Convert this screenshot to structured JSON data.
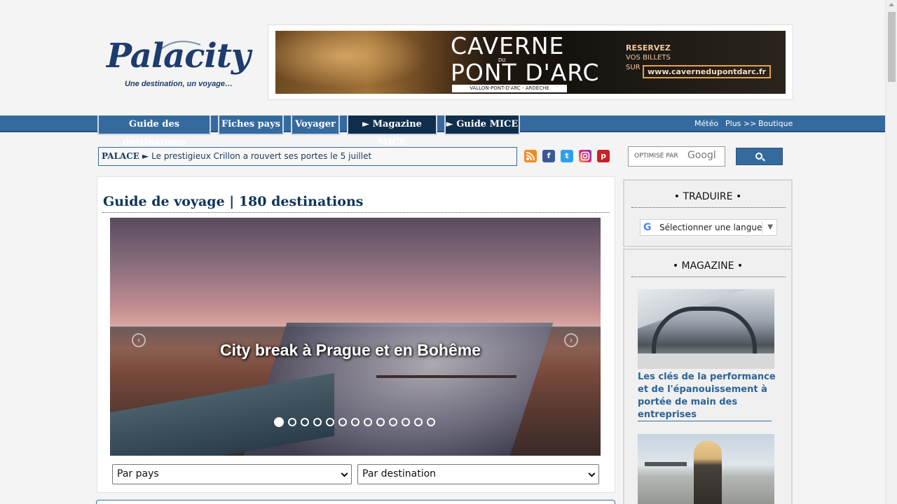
{
  "header": {
    "logo_text": "Palacity",
    "logo_tagline": "Une destination, un voyage…",
    "banner": {
      "title_line1": "CAVERNE",
      "title_du": "DU",
      "title_line2": "PONT D'ARC",
      "subtitle": "VALLON-PONT-D'ARC - ARDÈCHE",
      "reserve": "RESERVEZ",
      "vos_billets": "VOS BILLETS",
      "sur": "SUR",
      "url": "www.cavernedupontdarc.fr"
    }
  },
  "nav": {
    "tabs": [
      {
        "label": "Guide des destinations"
      },
      {
        "label": "Fiches pays"
      },
      {
        "label": "Voyager"
      },
      {
        "label": "► Magazine MICE"
      },
      {
        "label": "► Guide MICE"
      }
    ],
    "right": [
      "Météo",
      "Plus >>",
      "Boutique"
    ]
  },
  "ticker": {
    "label": "PALACE",
    "arrow": "►",
    "text": "Le prestigieux Crillon a rouvert ses portes le 5 juillet"
  },
  "social": [
    "rss-icon",
    "facebook-icon",
    "twitter-icon",
    "instagram-icon",
    "pinterest-icon"
  ],
  "search": {
    "label": "OPTIMISÉ PAR",
    "brand": "Googl"
  },
  "main": {
    "title": "Guide de voyage | 180 destinations",
    "slider": {
      "caption": "City break à Prague et en Bohême",
      "dot_count": 13,
      "active_dot": 0
    },
    "select_country": "Par pays",
    "select_destination": "Par destination"
  },
  "sidebar": {
    "translate": {
      "title": "• TRADUIRE •",
      "select_label": "Sélectionner une langue",
      "g": "G"
    },
    "magazine": {
      "title": "• MAGAZINE •",
      "article_title": "Les clés de la performance et de l'épanouissement à portée de main des entreprises"
    }
  },
  "colors": {
    "nav_blue": "#356a9f",
    "nav_dark": "#0f2e4c",
    "title_blue": "#0e3458",
    "link_blue": "#2c6395"
  }
}
